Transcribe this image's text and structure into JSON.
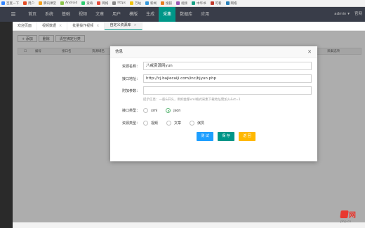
{
  "bookmarks": [
    {
      "label": "百度一下",
      "color": "#3385ff"
    },
    {
      "label": "用户",
      "color": "#e44d26"
    },
    {
      "label": "腾讯课堂",
      "color": "#f29d1b"
    },
    {
      "label": "Android",
      "color": "#8bc34a"
    },
    {
      "label": "爱奇",
      "color": "#2ecc71"
    },
    {
      "label": "网络",
      "color": "#e74c3c"
    },
    {
      "label": "https",
      "color": "#888888"
    },
    {
      "label": "万站",
      "color": "#f1c40f"
    },
    {
      "label": "新闻",
      "color": "#3498db"
    },
    {
      "label": "搜狐",
      "color": "#e67e22"
    },
    {
      "label": "视频",
      "color": "#9b59b6"
    },
    {
      "label": "中华书",
      "color": "#16a085"
    },
    {
      "label": "可看",
      "color": "#c0392b"
    },
    {
      "label": "网络",
      "color": "#2980b9"
    }
  ],
  "nav": {
    "items": [
      "首页",
      "系统",
      "基础",
      "视频",
      "文章",
      "用户",
      "模版",
      "生成",
      "采集",
      "数据库",
      "应用"
    ],
    "active_index": 8,
    "admin": "admin ▾",
    "logout": "官网"
  },
  "tabs": [
    {
      "label": "欢迎页面",
      "closable": false
    },
    {
      "label": "视频数据",
      "closable": true
    },
    {
      "label": "批量操作视频",
      "closable": true
    },
    {
      "label": "自定义资源库",
      "closable": true,
      "active": true
    }
  ],
  "toolbar": {
    "add": "+ 添加",
    "delete": "删除",
    "clear": "清空绑定分类"
  },
  "grid": {
    "headers": [
      "编号",
      "接口名",
      "资源域名",
      "采集选项"
    ]
  },
  "dialog": {
    "title": "信息",
    "close": "✕",
    "name_label": "资源名称：",
    "name_value": "八戒资源网yun",
    "api_label": "接口地址：",
    "api_value": "http://cj.bajiecaiji.com/inc/bjyun.php",
    "param_label": "附加参数：",
    "param_value": "",
    "hint": "提示信息：一般&开头，例如金都xml格式采集下载地址需加入&ct=1",
    "type_label": "接口类型：",
    "type_options": [
      "xml",
      "json"
    ],
    "type_selected": 1,
    "res_label": "资源类型：",
    "res_options": [
      "视频",
      "文章",
      "演员"
    ],
    "res_selected": -1,
    "btn_test": "测 试",
    "btn_save": "保 存",
    "btn_cancel": "返 回"
  },
  "colors": {
    "nav_bg": "#393d49",
    "accent": "#009688",
    "btn_test": "#1e9fff",
    "btn_save": "#009688",
    "btn_cancel": "#ffb800"
  },
  "watermark": {
    "text": "网",
    "sub": "php.cn"
  }
}
